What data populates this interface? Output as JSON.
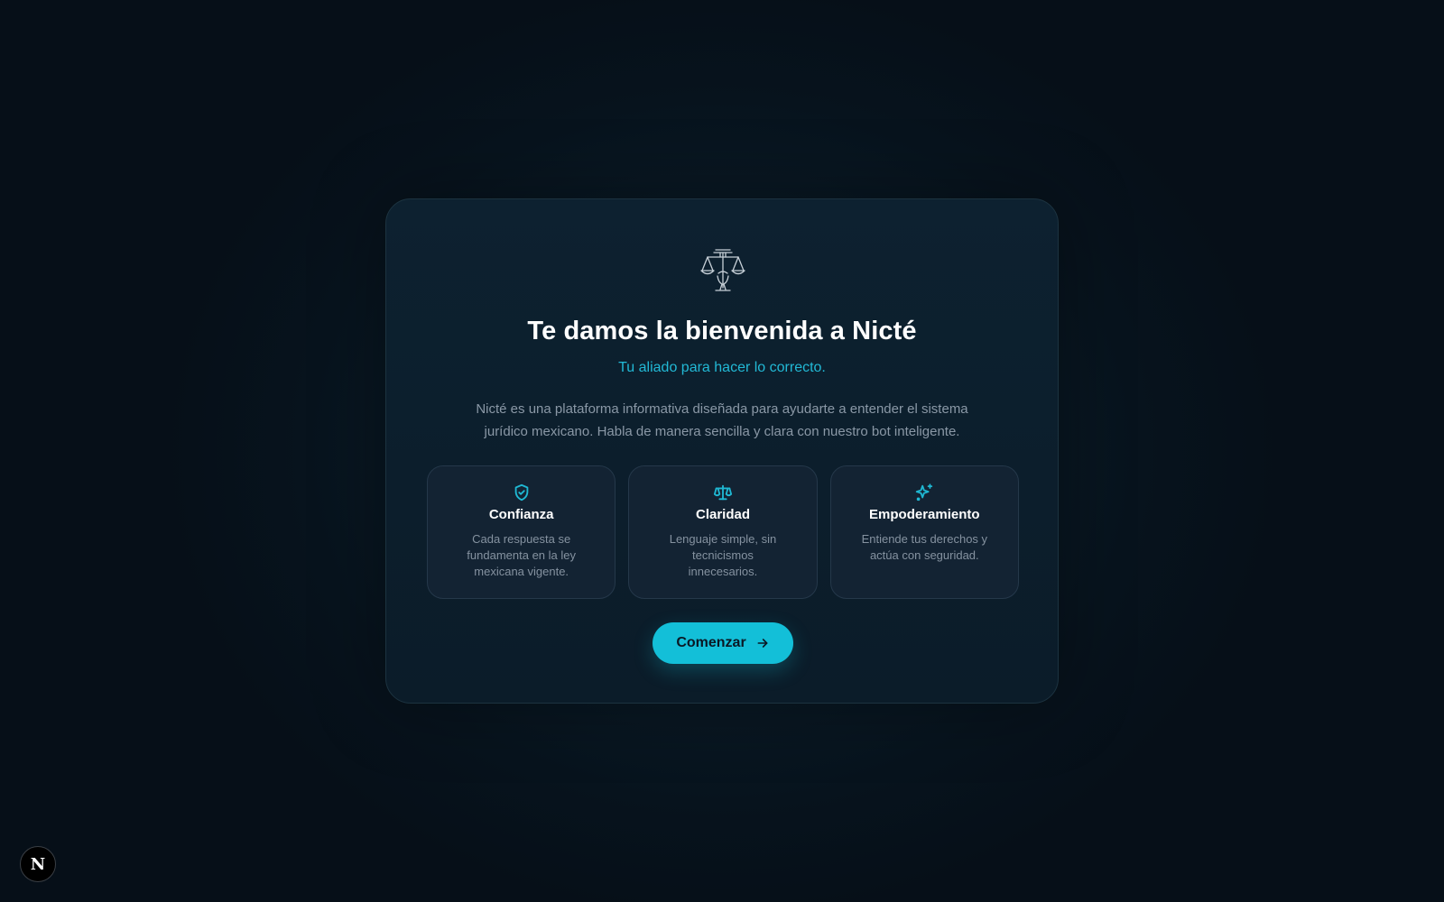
{
  "welcome": {
    "logo_icon": "scales-of-justice-icon",
    "title": "Te damos la bienvenida a Nicté",
    "subtitle": "Tu aliado para hacer lo correcto.",
    "description": "Nicté es una plataforma informativa diseñada para ayudarte a entender el sistema jurídico mexicano. Habla de manera sencilla y clara con nuestro bot inteligente.",
    "features": [
      {
        "icon": "shield-check-icon",
        "name": "Confianza",
        "description": "Cada respuesta se fundamenta en la ley mexicana vigente."
      },
      {
        "icon": "scale-icon",
        "name": "Claridad",
        "description": "Lenguaje simple, sin tecnicismos innecesarios."
      },
      {
        "icon": "sparkles-icon",
        "name": "Empoderamiento",
        "description": "Entiende tus derechos y actúa con seguridad."
      }
    ],
    "cta_label": "Comenzar",
    "cta_icon": "arrow-right-icon"
  },
  "dev_badge": {
    "label": "N"
  },
  "colors": {
    "accent": "#13bfd8",
    "subtitle": "#22b9d6",
    "card_bg": "#0d2130",
    "feature_bg": "#132333",
    "background": "#07131d"
  }
}
